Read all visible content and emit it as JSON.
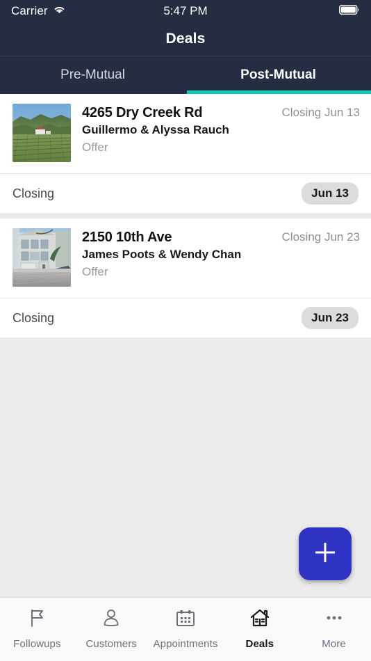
{
  "status_bar": {
    "carrier": "Carrier",
    "wifi_icon": "wifi-icon",
    "time": "5:47 PM",
    "battery_icon": "battery-full-icon"
  },
  "header": {
    "title": "Deals"
  },
  "tabs": {
    "items": [
      {
        "label": "Pre-Mutual",
        "active": false
      },
      {
        "label": "Post-Mutual",
        "active": true
      }
    ],
    "indicator_color": "#0FC9B5"
  },
  "deals": [
    {
      "address": "4265 Dry Creek Rd",
      "clients": "Guillermo & Alyssa Rauch",
      "stage": "Offer",
      "closing_summary": "Closing Jun 13",
      "thumbnail": "aerial-vineyard-photo",
      "closing_row": {
        "label": "Closing",
        "badge": "Jun 13"
      }
    },
    {
      "address": "2150 10th Ave",
      "clients": "James Poots & Wendy Chan",
      "stage": "Offer",
      "closing_summary": "Closing Jun 23",
      "thumbnail": "street-view-house-photo",
      "closing_row": {
        "label": "Closing",
        "badge": "Jun 23"
      }
    }
  ],
  "fab": {
    "icon": "plus-icon",
    "color": "#2F34C4"
  },
  "bottom_nav": {
    "items": [
      {
        "label": "Followups",
        "icon": "flag-icon",
        "active": false
      },
      {
        "label": "Customers",
        "icon": "person-icon",
        "active": false
      },
      {
        "label": "Appointments",
        "icon": "calendar-icon",
        "active": false
      },
      {
        "label": "Deals",
        "icon": "house-icon",
        "active": true
      },
      {
        "label": "More",
        "icon": "ellipsis-icon",
        "active": false
      }
    ]
  },
  "colors": {
    "header_navy": "#252D42",
    "accent_teal": "#0FC9B5",
    "fab_blue": "#2F34C4",
    "page_background": "#EBEBEB"
  }
}
